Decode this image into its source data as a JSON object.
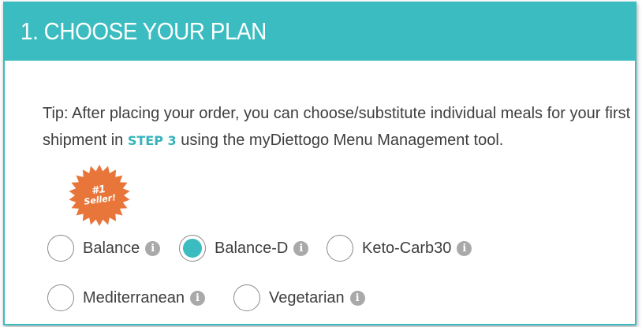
{
  "header": {
    "title": "1. CHOOSE YOUR PLAN"
  },
  "tip": {
    "text_before": "Tip: After placing your order, you can choose/substitute individual meals for your first shipment in ",
    "step_link": "STEP 3",
    "text_after": " using the myDiettogo Menu Management tool."
  },
  "badge": {
    "line1": "#1",
    "line2": "Seller!",
    "color": "#e8763a"
  },
  "plans": [
    {
      "label": "Balance",
      "selected": false
    },
    {
      "label": "Balance-D",
      "selected": true
    },
    {
      "label": "Keto-Carb30",
      "selected": false
    },
    {
      "label": "Mediterranean",
      "selected": false
    },
    {
      "label": "Vegetarian",
      "selected": false
    }
  ],
  "info_icon": "i",
  "colors": {
    "accent": "#3bbcc1",
    "text": "#3e3e3e",
    "info": "#a9a9a9"
  }
}
